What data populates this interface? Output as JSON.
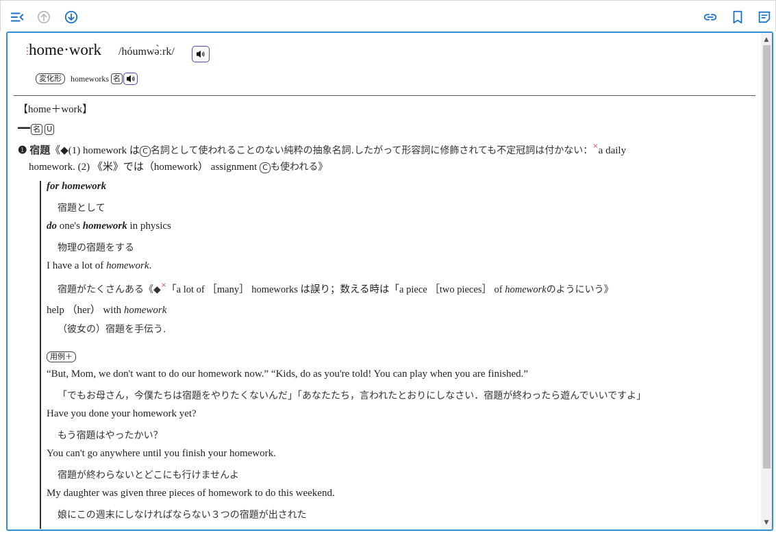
{
  "toolbar": {
    "icons": [
      "menu-collapse-icon",
      "arrow-up-circle-icon",
      "arrow-down-circle-icon",
      "link-icon",
      "bookmark-icon",
      "note-icon"
    ],
    "accent": "#2f8fd8"
  },
  "entry": {
    "headword": "home·work",
    "pronunciation": "/hóumwə̀ːrk/",
    "inflection_label": "変化形",
    "inflection_form": "homeworks",
    "inflection_pos": "名",
    "etymology": "【home＋work】",
    "pos_dash": "━━",
    "pos": "名",
    "countability": "U",
    "sense_number": "❶",
    "sense_word": "宿題",
    "note_open": "《◆(1) homework は",
    "note_c": "C",
    "note_mid": "名詞として使われることのない純粋の抽象名詞.したがって形容詞に修飾されても不定冠詞は付かない：",
    "note_x": "×",
    "note_tail": "a daily",
    "note_line2_a": "homework. (2) 《米》では（homework） assignment ",
    "note_line2_c": "C",
    "note_line2_b": "も使われる》",
    "phrases": {
      "p1_en": "for homework",
      "p1_ja": "宿題として",
      "p2_bold": "do",
      "p2_mid": " one's ",
      "p2_bi": "homework",
      "p2_tail": " in physics",
      "p2_ja": "物理の宿題をする",
      "p3_a": "I have a lot of ",
      "p3_i": "homework",
      "p3_b": ".",
      "p3_ja_a": "宿題がたくさんある《◆",
      "p3_x": "×",
      "p3_ja_b": "「a lot of ［many］ homeworks は誤り；数える時は「a piece ［two pieces］ of ",
      "p3_i2": "homework",
      "p3_ja_c": "のようにいう》",
      "p4_a": "help （her） with ",
      "p4_i": "homework",
      "p4_ja": "（彼女の）宿題を手伝う."
    },
    "examples_label": "用例＋",
    "examples": [
      {
        "en": "“But, Mom, we don't want to do our homework now.” “Kids, do as you're told! You can play when you are finished.”",
        "ja": "「でもお母さん，今僕たちは宿題をやりたくないんだ」「あなたたち，言われたとおりにしなさい．宿題が終わったら遊んでいいですよ」"
      },
      {
        "en": "Have you done your homework yet?",
        "ja": "もう宿題はやったかい？"
      },
      {
        "en": "You can't go anywhere until you finish your homework.",
        "ja": "宿題が終わらないとどこにも行けませんよ"
      },
      {
        "en": "My daughter was given three pieces of homework to do this weekend.",
        "ja": "娘にこの週末にしなければならない３つの宿題が出された"
      }
    ]
  },
  "scrollbar": {
    "up": "▲",
    "down": "▼"
  }
}
